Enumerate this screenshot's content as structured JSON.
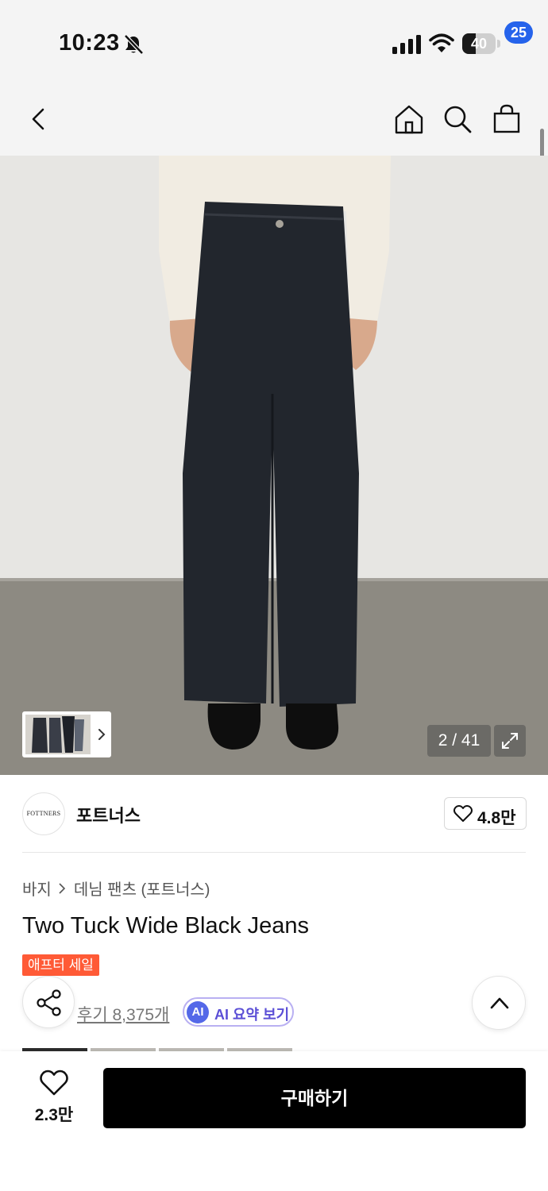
{
  "status_bar": {
    "time": "10:23",
    "battery_percent": "40",
    "battery_level": 0.4,
    "icons": [
      "bell-slash-icon",
      "cellular-signal-icon",
      "wifi-icon",
      "battery-icon"
    ]
  },
  "header": {
    "icons": [
      "back-chevron-icon",
      "home-icon",
      "search-icon",
      "shopping-bag-icon"
    ],
    "cart_count": "25"
  },
  "gallery": {
    "current": 2,
    "total": 41,
    "counter_text": "2 / 41"
  },
  "brand": {
    "logo_text": "FOTTNERS",
    "name": "포트너스",
    "like_count": "4.8만"
  },
  "product": {
    "breadcrumb": [
      "바지",
      "데님 팬츠 (포트너스)"
    ],
    "title": "Two Tuck Wide Black Jeans",
    "sale_badge": "애프터 세일",
    "review_text": "후기 8,375개",
    "ai_logo": "AI",
    "ai_summary_label": "AI 요약 보기"
  },
  "bottom_bar": {
    "wish_count": "2.3만",
    "buy_label": "구매하기"
  },
  "colors": {
    "accent_blue": "#2563eb",
    "sale_orange": "#ff5a36",
    "ai_purple": "#5b4fd6",
    "buy_black": "#000000"
  }
}
